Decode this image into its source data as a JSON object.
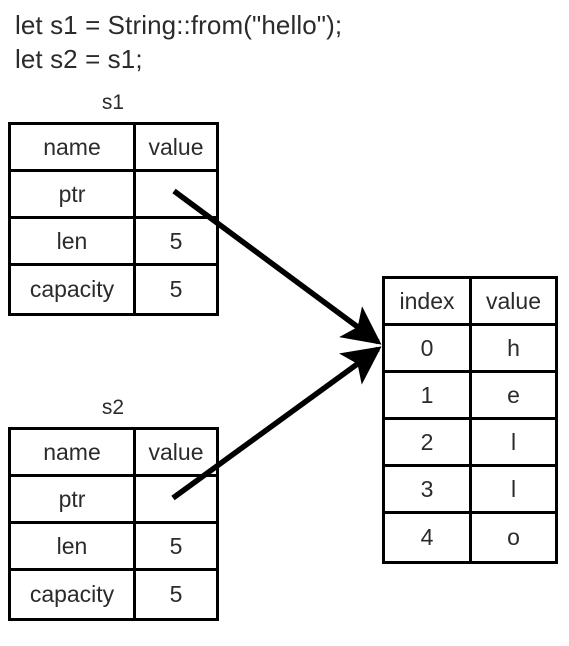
{
  "code": {
    "lines": [
      "let s1 = String::from(\"hello\");",
      "let s2 = s1;"
    ]
  },
  "stack_tables": [
    {
      "caption": "s1",
      "header": {
        "name": "name",
        "value": "value"
      },
      "rows": [
        {
          "name": "ptr",
          "value": ""
        },
        {
          "name": "len",
          "value": "5"
        },
        {
          "name": "capacity",
          "value": "5"
        }
      ]
    },
    {
      "caption": "s2",
      "header": {
        "name": "name",
        "value": "value"
      },
      "rows": [
        {
          "name": "ptr",
          "value": ""
        },
        {
          "name": "len",
          "value": "5"
        },
        {
          "name": "capacity",
          "value": "5"
        }
      ]
    }
  ],
  "heap_table": {
    "header": {
      "index": "index",
      "value": "value"
    },
    "rows": [
      {
        "index": "0",
        "value": "h"
      },
      {
        "index": "1",
        "value": "e"
      },
      {
        "index": "2",
        "value": "l"
      },
      {
        "index": "3",
        "value": "l"
      },
      {
        "index": "4",
        "value": "o"
      }
    ]
  },
  "arrows": [
    {
      "name": "s1-ptr-to-heap",
      "from": "s1.ptr",
      "to": "heap.index0"
    },
    {
      "name": "s2-ptr-to-heap",
      "from": "s2.ptr",
      "to": "heap.index0"
    }
  ],
  "colors": {
    "line": "#000000",
    "text": "#2b2b2b",
    "background": "#ffffff"
  }
}
